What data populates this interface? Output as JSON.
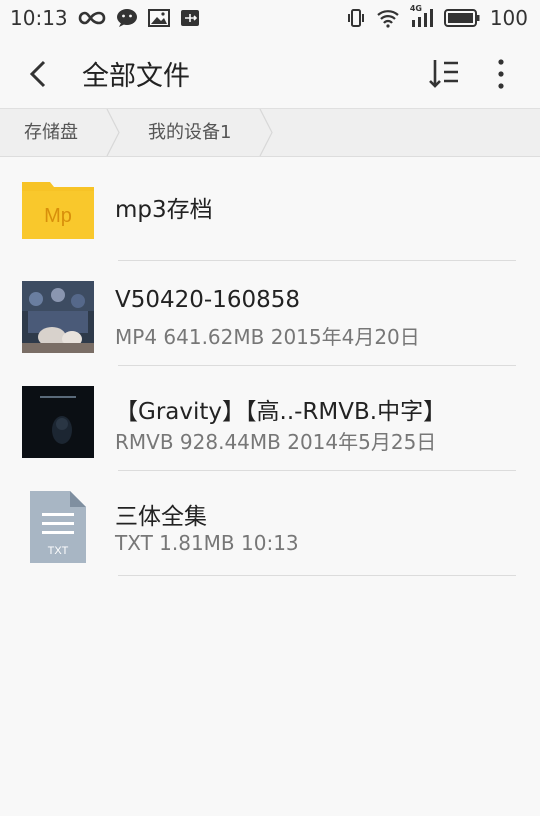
{
  "status": {
    "time": "10:13",
    "battery": "100",
    "network": "4G"
  },
  "appbar": {
    "title": "全部文件"
  },
  "breadcrumb": [
    "存储盘",
    "我的设备1"
  ],
  "files": [
    {
      "name": "mp3存档",
      "meta": "",
      "type": "folder",
      "badge": "Mp"
    },
    {
      "name": "V50420-160858",
      "meta": "MP4  641.62MB  2015年4月20日",
      "type": "video"
    },
    {
      "name": "【Gravity】【高..-RMVB.中字】",
      "meta": "RMVB  928.44MB  2014年5月25日",
      "type": "video-dark"
    },
    {
      "name": "三体全集",
      "meta": "TXT  1.81MB  10:13",
      "type": "txt",
      "badge": "TXT"
    }
  ],
  "colors": {
    "folder": "#f7c326",
    "folder_text": "#d88f0b",
    "txt_doc": "#a8b6c4",
    "background": "#f8f8f8"
  }
}
